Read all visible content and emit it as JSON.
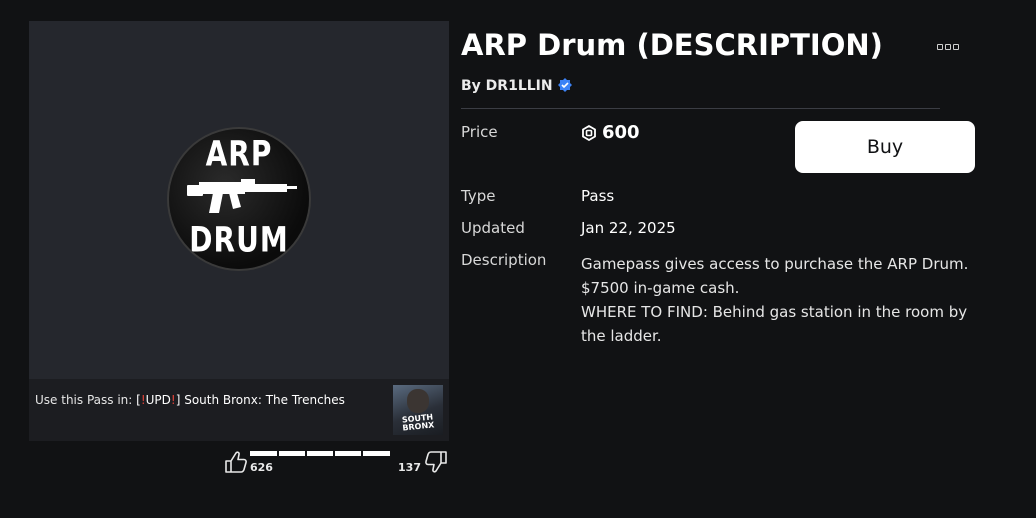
{
  "item": {
    "title": "ARP Drum (DESCRIPTION)",
    "by_prefix": "By",
    "creator": "DR1LLIN"
  },
  "thumbnail": {
    "top_text": "ARP",
    "bottom_text": "DRUM"
  },
  "usage": {
    "prefix": "Use this Pass in:",
    "bracket_open": "[",
    "bang": "!",
    "tag": "UPD",
    "bracket_close": "]",
    "game_name": "South Bronx: The Trenches",
    "game_thumb_text": "SOUTH BRONX"
  },
  "votes": {
    "up": "626",
    "down": "137"
  },
  "details": {
    "price_label": "Price",
    "price_value": "600",
    "type_label": "Type",
    "type_value": "Pass",
    "updated_label": "Updated",
    "updated_value": "Jan 22, 2025",
    "description_label": "Description",
    "description_lines": [
      "Gamepass gives access to purchase the ARP Drum.",
      "$7500 in-game cash.",
      "WHERE TO FIND: Behind gas station in the room by",
      "the ladder."
    ]
  },
  "actions": {
    "buy_label": "Buy"
  },
  "icons": {
    "verified": "verified-badge-icon",
    "robux": "robux-icon",
    "more": "more-options-icon",
    "thumbs_up": "thumbs-up-icon",
    "thumbs_down": "thumbs-down-icon"
  },
  "colors": {
    "background": "#111214",
    "panel": "#25272d",
    "verified": "#3b82f6",
    "warn": "#e5433a",
    "buy_button": "#ffffff"
  }
}
